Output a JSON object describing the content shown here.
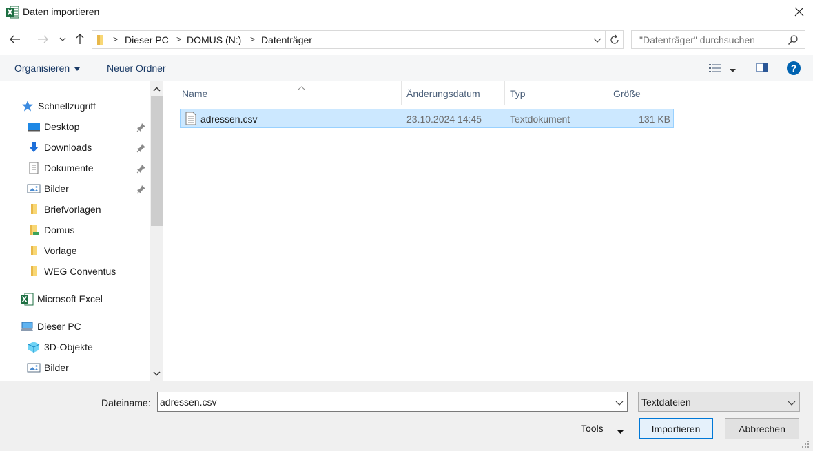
{
  "window": {
    "title": "Daten importieren",
    "app_icon": "excel-icon"
  },
  "address": {
    "crumbs": [
      "Dieser PC",
      "DOMUS (N:)",
      "Datenträger"
    ],
    "search_placeholder": "\"Datenträger\" durchsuchen"
  },
  "toolbar": {
    "organize": "Organisieren",
    "new_folder": "Neuer Ordner"
  },
  "nav": {
    "items": [
      {
        "label": "Schnellzugriff",
        "icon": "star-icon"
      },
      {
        "label": "Desktop",
        "icon": "desktop-icon",
        "pinned": true
      },
      {
        "label": "Downloads",
        "icon": "download-icon",
        "pinned": true
      },
      {
        "label": "Dokumente",
        "icon": "document-icon",
        "pinned": true
      },
      {
        "label": "Bilder",
        "icon": "pictures-icon",
        "pinned": true
      },
      {
        "label": "Briefvorlagen",
        "icon": "folder-icon"
      },
      {
        "label": "Domus",
        "icon": "folder-icon"
      },
      {
        "label": "Vorlage",
        "icon": "folder-icon"
      },
      {
        "label": "WEG Conventus",
        "icon": "folder-icon"
      },
      {
        "label": "Microsoft Excel",
        "icon": "excel-icon"
      },
      {
        "label": "Dieser PC",
        "icon": "computer-icon"
      },
      {
        "label": "3D-Objekte",
        "icon": "cube-icon"
      },
      {
        "label": "Bilder",
        "icon": "pictures-icon"
      }
    ]
  },
  "files": {
    "columns": [
      "Name",
      "Änderungsdatum",
      "Typ",
      "Größe"
    ],
    "rows": [
      {
        "name": "adressen.csv",
        "date": "23.10.2024 14:45",
        "type": "Textdokument",
        "size": "131 KB",
        "selected": true
      }
    ]
  },
  "footer": {
    "filename_label": "Dateiname:",
    "filename_value": "adressen.csv",
    "filetype": "Textdateien",
    "tools": "Tools",
    "import_button": "Importieren",
    "cancel_button": "Abbrechen"
  },
  "colors": {
    "selection": "#cce8ff",
    "selection_border": "#99d1ff",
    "accent": "#0078d7",
    "excel": "#1d6f42"
  }
}
